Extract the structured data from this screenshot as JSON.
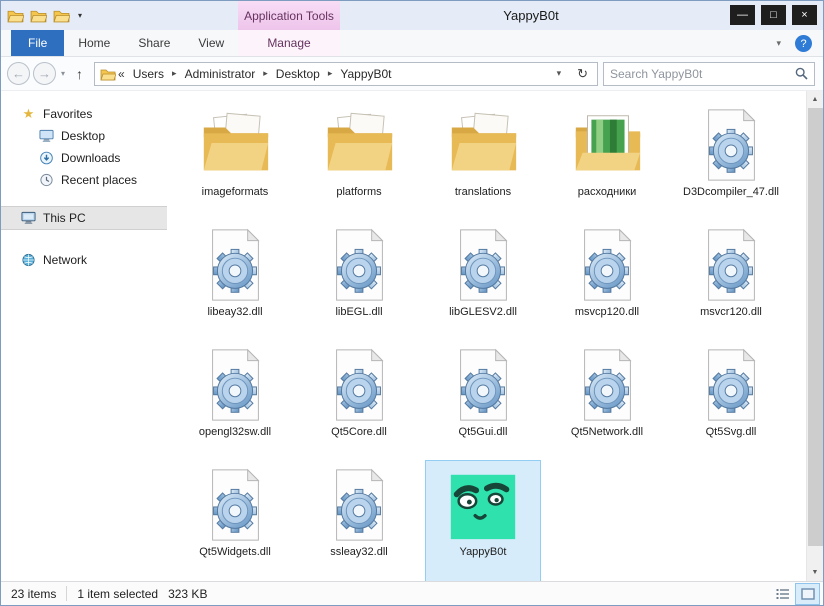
{
  "window": {
    "title": "YappyB0t",
    "context_header": "Application Tools"
  },
  "icons": {
    "back": "←",
    "forward": "→",
    "dropdown": "▾",
    "up": "↑",
    "refresh": "↻",
    "overflow": "«",
    "crumb_sep": "▸",
    "minimize": "—",
    "maximize": "□",
    "close": "×",
    "ribbon_chevron": "▾",
    "help": "?",
    "star": "★",
    "scroll_up": "▲",
    "scroll_down": "▼"
  },
  "ribbon": {
    "file_tab": "File",
    "tabs": [
      {
        "label": "Home"
      },
      {
        "label": "Share"
      },
      {
        "label": "View"
      }
    ],
    "context_tab": "Manage"
  },
  "address": {
    "crumbs": [
      "Users",
      "Administrator",
      "Desktop",
      "YappyB0t"
    ]
  },
  "search": {
    "placeholder": "Search YappyB0t"
  },
  "sidebar": {
    "favorites": {
      "label": "Favorites",
      "items": [
        {
          "label": "Desktop"
        },
        {
          "label": "Downloads"
        },
        {
          "label": "Recent places"
        }
      ]
    },
    "this_pc": {
      "label": "This PC"
    },
    "network": {
      "label": "Network"
    }
  },
  "files": [
    {
      "name": "imageformats",
      "type": "folder"
    },
    {
      "name": "platforms",
      "type": "folder"
    },
    {
      "name": "translations",
      "type": "folder"
    },
    {
      "name": "расходники",
      "type": "folder-image"
    },
    {
      "name": "D3Dcompiler_47.dll",
      "type": "dll"
    },
    {
      "name": "libeay32.dll",
      "type": "dll"
    },
    {
      "name": "libEGL.dll",
      "type": "dll"
    },
    {
      "name": "libGLESV2.dll",
      "type": "dll"
    },
    {
      "name": "msvcp120.dll",
      "type": "dll"
    },
    {
      "name": "msvcr120.dll",
      "type": "dll"
    },
    {
      "name": "opengl32sw.dll",
      "type": "dll"
    },
    {
      "name": "Qt5Core.dll",
      "type": "dll"
    },
    {
      "name": "Qt5Gui.dll",
      "type": "dll"
    },
    {
      "name": "Qt5Network.dll",
      "type": "dll"
    },
    {
      "name": "Qt5Svg.dll",
      "type": "dll"
    },
    {
      "name": "Qt5Widgets.dll",
      "type": "dll"
    },
    {
      "name": "ssleay32.dll",
      "type": "dll"
    },
    {
      "name": "YappyB0t",
      "type": "app",
      "selected": true
    }
  ],
  "status": {
    "count": "23 items",
    "selected": "1 item selected",
    "size": "323 KB"
  }
}
